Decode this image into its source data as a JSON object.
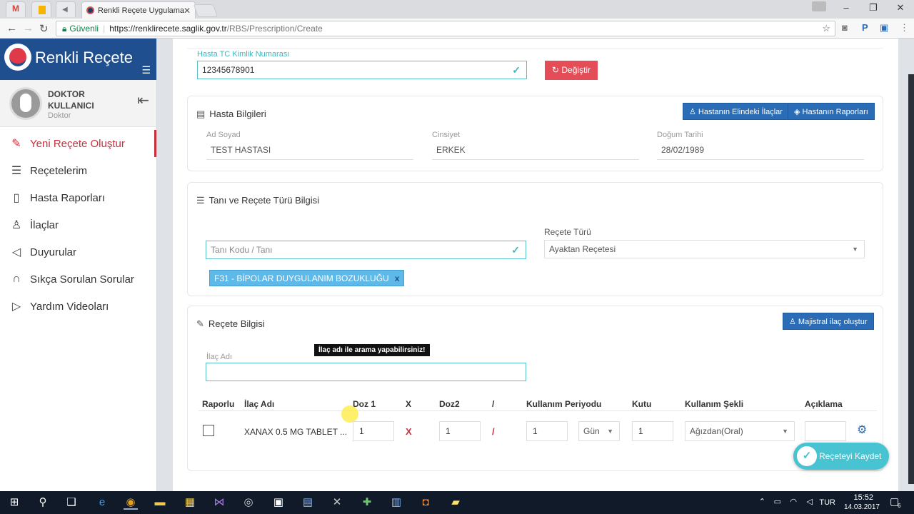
{
  "browser": {
    "tab_title": "Renkli Reçete Uygulama",
    "secure_label": "Güvenli",
    "url_base": "https://renklirecete.saglik.gov.tr",
    "url_path": "/RBS/Prescription/Create"
  },
  "sidebar": {
    "brand": "Renkli Reçete",
    "user_name_1": "DOKTOR",
    "user_name_2": "KULLANICI",
    "user_role": "Doktor",
    "items": [
      {
        "label": "Yeni Reçete Oluştur",
        "icon": "edit-icon"
      },
      {
        "label": "Reçetelerim",
        "icon": "list-icon"
      },
      {
        "label": "Hasta Raporları",
        "icon": "notebook-icon"
      },
      {
        "label": "İlaçlar",
        "icon": "pharmacist-icon"
      },
      {
        "label": "Duyurular",
        "icon": "speaker-icon"
      },
      {
        "label": "Sıkça Sorulan Sorular",
        "icon": "headset-icon"
      },
      {
        "label": "Yardım Videoları",
        "icon": "video-icon"
      }
    ]
  },
  "patient_id": {
    "label": "Hasta TC Kimlik Numarası",
    "value": "12345678901",
    "change_button": "Değiştir"
  },
  "patient_info": {
    "title": "Hasta Bilgileri",
    "btn_drugs": "Hastanın Elindeki İlaçlar",
    "btn_reports": "Hastanın Raporları",
    "name_label": "Ad Soyad",
    "name_value": "TEST HASTASI",
    "gender_label": "Cinsiyet",
    "gender_value": "ERKEK",
    "birth_label": "Doğum Tarihi",
    "birth_value": "28/02/1989"
  },
  "diagnosis": {
    "title": "Tanı ve Reçete Türü Bilgisi",
    "search_placeholder": "Tanı Kodu / Tanı",
    "type_label": "Reçete Türü",
    "type_value": "Ayaktan Reçetesi",
    "tag": "F31 - BİPOLAR DUYGULANIM BOZUKLUĞU",
    "tag_remove": "x"
  },
  "prescription": {
    "title": "Reçete Bilgisi",
    "btn_majistral": "Majistral ilaç oluştur",
    "drug_label": "İlaç Adı",
    "tooltip": "İlaç adı ile arama yapabilirsiniz!",
    "headers": [
      "Raporlu",
      "İlaç Adı",
      "Doz 1",
      "X",
      "Doz2",
      "/",
      "Kullanım Periyodu",
      "Kutu",
      "Kullanım Şekli",
      "Açıklama"
    ],
    "row": {
      "drug": "XANAX 0.5 MG TABLET ...",
      "dose1": "1",
      "x": "X",
      "dose2": "1",
      "slash": "/",
      "period": "1",
      "period_unit": "Gün",
      "box": "1",
      "usage": "Ağızdan(Oral)"
    },
    "save_button": "Reçeteyi Kaydet"
  },
  "taskbar": {
    "lang": "TUR",
    "time": "15:52",
    "date": "14.03.2017",
    "notif_count": "6"
  }
}
